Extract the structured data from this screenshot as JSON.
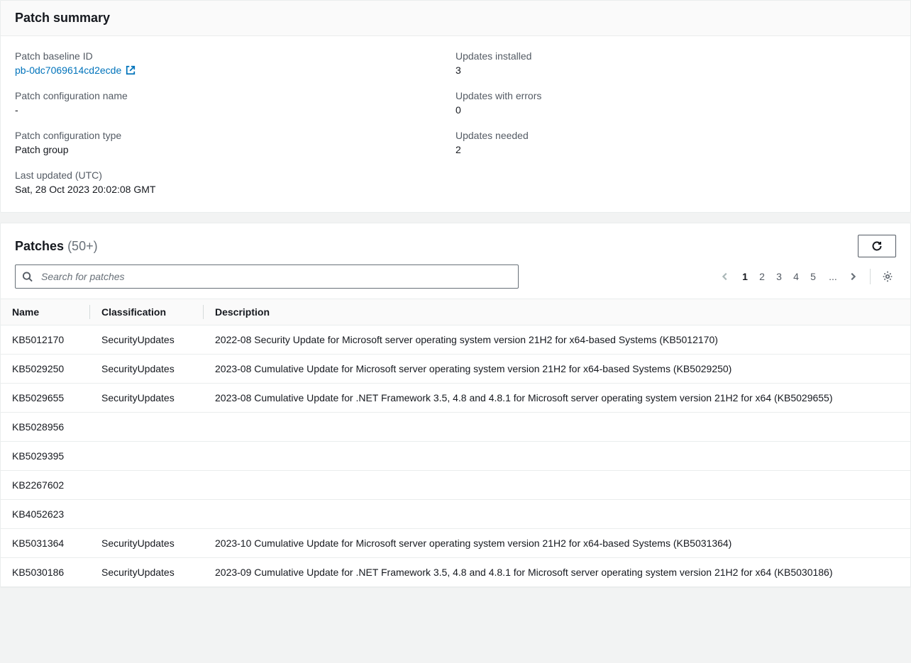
{
  "summary": {
    "title": "Patch summary",
    "left": {
      "baseline_id_label": "Patch baseline ID",
      "baseline_id_value": "pb-0dc7069614cd2ecde",
      "config_name_label": "Patch configuration name",
      "config_name_value": "-",
      "config_type_label": "Patch configuration type",
      "config_type_value": "Patch group",
      "last_updated_label": "Last updated (UTC)",
      "last_updated_value": "Sat, 28 Oct 2023 20:02:08 GMT"
    },
    "right": {
      "installed_label": "Updates installed",
      "installed_value": "3",
      "errors_label": "Updates with errors",
      "errors_value": "0",
      "needed_label": "Updates needed",
      "needed_value": "2"
    }
  },
  "patches": {
    "title": "Patches",
    "count_text": "(50+)",
    "search_placeholder": "Search for patches",
    "pagination": {
      "pages": [
        "1",
        "2",
        "3",
        "4",
        "5"
      ],
      "ellipsis": "...",
      "current": "1"
    },
    "columns": {
      "name": "Name",
      "classification": "Classification",
      "description": "Description"
    },
    "rows": [
      {
        "name": "KB5012170",
        "classification": "SecurityUpdates",
        "description": "2022-08 Security Update for Microsoft server operating system version 21H2 for x64-based Systems (KB5012170)"
      },
      {
        "name": "KB5029250",
        "classification": "SecurityUpdates",
        "description": "2023-08 Cumulative Update for Microsoft server operating system version 21H2 for x64-based Systems (KB5029250)"
      },
      {
        "name": "KB5029655",
        "classification": "SecurityUpdates",
        "description": "2023-08 Cumulative Update for .NET Framework 3.5, 4.8 and 4.8.1 for Microsoft server operating system version 21H2 for x64 (KB5029655)"
      },
      {
        "name": "KB5028956",
        "classification": "",
        "description": ""
      },
      {
        "name": "KB5029395",
        "classification": "",
        "description": ""
      },
      {
        "name": "KB2267602",
        "classification": "",
        "description": ""
      },
      {
        "name": "KB4052623",
        "classification": "",
        "description": ""
      },
      {
        "name": "KB5031364",
        "classification": "SecurityUpdates",
        "description": "2023-10 Cumulative Update for Microsoft server operating system version 21H2 for x64-based Systems (KB5031364)"
      },
      {
        "name": "KB5030186",
        "classification": "SecurityUpdates",
        "description": "2023-09 Cumulative Update for .NET Framework 3.5, 4.8 and 4.8.1 for Microsoft server operating system version 21H2 for x64 (KB5030186)"
      }
    ]
  }
}
